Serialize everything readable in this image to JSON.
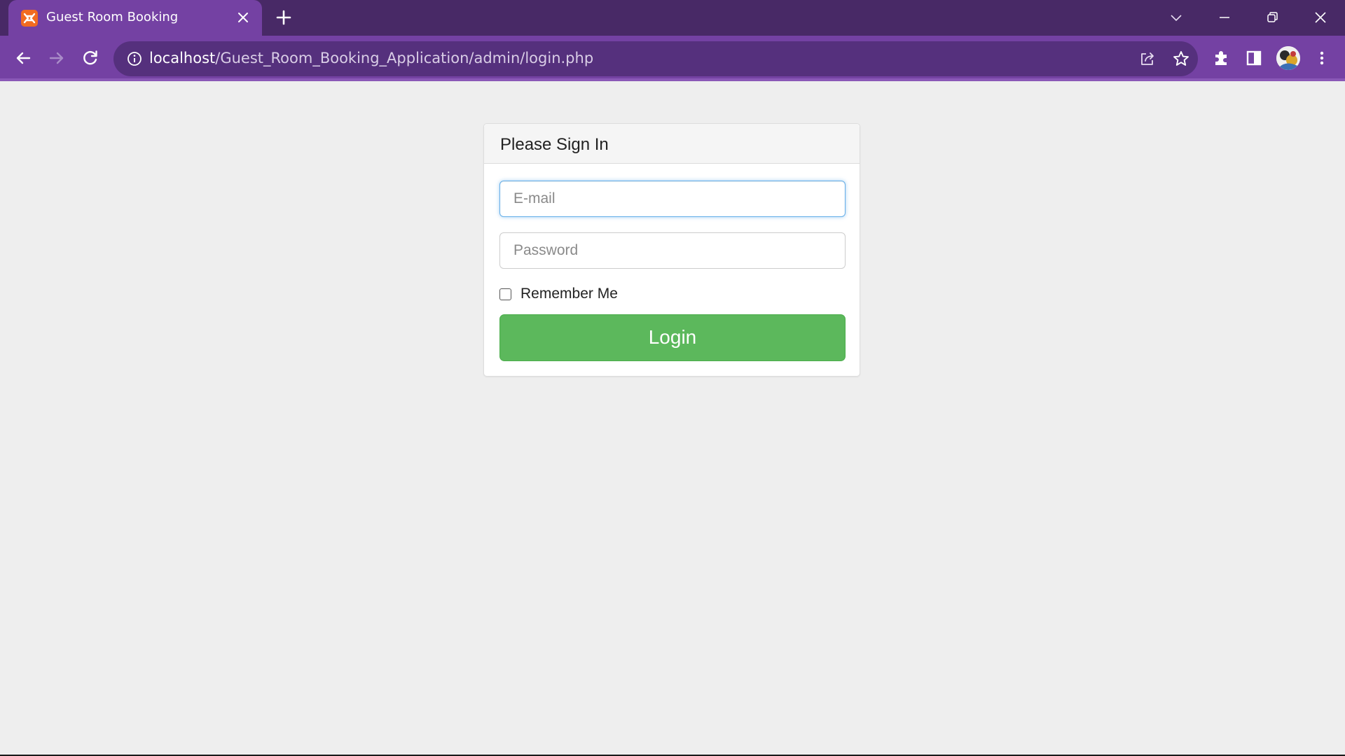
{
  "browser": {
    "tab_title": "Guest Room Booking",
    "url_host": "localhost",
    "url_path": "/Guest_Room_Booking_Application/admin/login.php",
    "theme": {
      "frame": "#482966",
      "toolbar": "#7441a3",
      "omnibox": "#55307d"
    }
  },
  "login": {
    "heading": "Please Sign In",
    "email_placeholder": "E-mail",
    "email_value": "",
    "password_placeholder": "Password",
    "password_value": "",
    "remember_label": "Remember Me",
    "remember_checked": false,
    "submit_label": "Login",
    "submit_color": "#5cb85c"
  },
  "icons": [
    "xampp-favicon",
    "close-icon",
    "plus-icon",
    "chevron-down-icon",
    "minimize-icon",
    "restore-icon",
    "close-window-icon",
    "back-arrow-icon",
    "forward-arrow-icon",
    "reload-icon",
    "info-icon",
    "share-icon",
    "star-icon",
    "puzzle-icon",
    "side-panel-icon",
    "avatar",
    "kebab-menu-icon"
  ]
}
